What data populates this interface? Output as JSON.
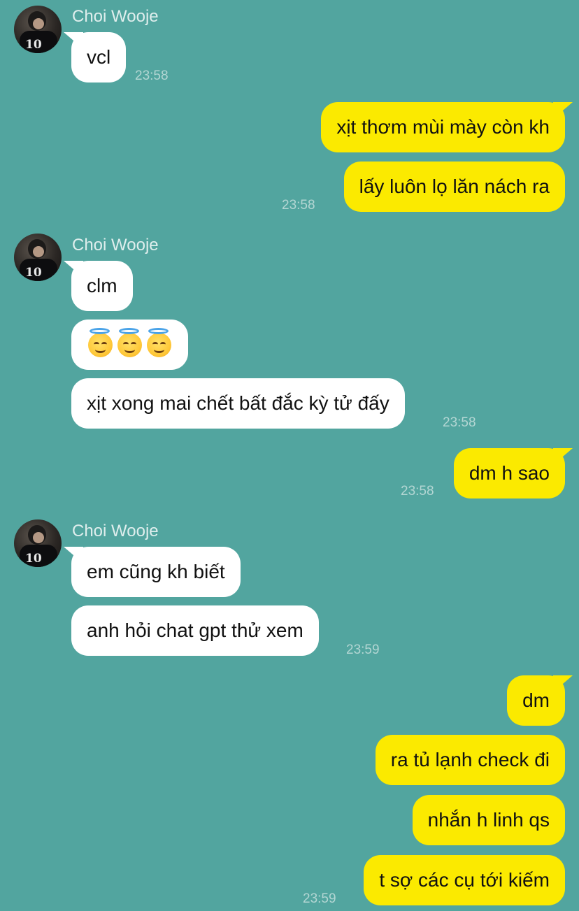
{
  "contact": {
    "name": "Choi Wooje",
    "avatar_number": "10"
  },
  "messages": [
    {
      "sender": "in",
      "text": "vcl"
    },
    {
      "sender": "out",
      "text": "xịt thơm mùi mày còn kh"
    },
    {
      "sender": "out",
      "text": "lấy luôn lọ lăn nách ra"
    },
    {
      "sender": "in",
      "text": "clm"
    },
    {
      "sender": "in",
      "emoji": [
        "smiling-face-with-halo",
        "smiling-face-with-halo",
        "smiling-face-with-halo"
      ]
    },
    {
      "sender": "in",
      "text": "xịt xong mai chết bất đắc kỳ tử đấy"
    },
    {
      "sender": "out",
      "text": "dm h sao"
    },
    {
      "sender": "in",
      "text": "em cũng kh biết"
    },
    {
      "sender": "in",
      "text": "anh hỏi chat gpt thử xem"
    },
    {
      "sender": "out",
      "text": "dm"
    },
    {
      "sender": "out",
      "text": "ra tủ lạnh check đi"
    },
    {
      "sender": "out",
      "text": "nhắn h linh qs"
    },
    {
      "sender": "out",
      "text": "t sợ các cụ tới kiếm"
    }
  ],
  "timestamps": [
    "23:58",
    "23:58",
    "23:58",
    "23:58",
    "23:59",
    "23:59"
  ],
  "colors": {
    "background": "#52a59f",
    "incoming_bubble": "#ffffff",
    "outgoing_bubble": "#fbea00",
    "timestamp": "#b3d6d3",
    "name": "#dfeeed"
  }
}
